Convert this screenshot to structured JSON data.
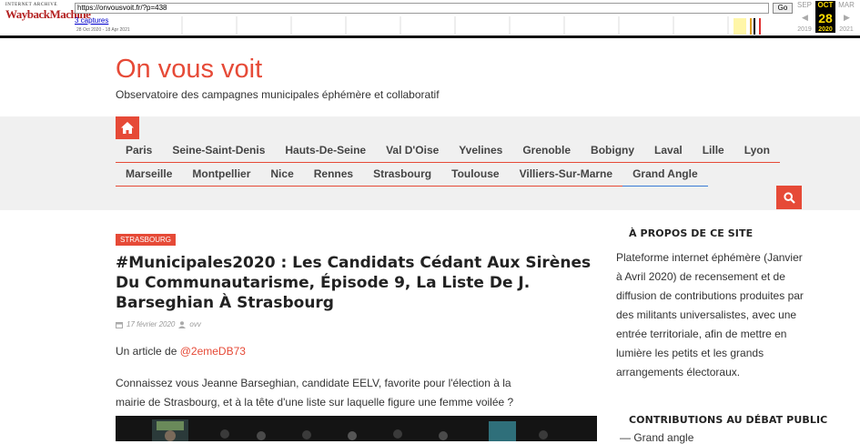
{
  "wayback": {
    "logo_top": "INTERNET ARCHIVE",
    "logo_main": "WaybackMachine",
    "url": "https://onvousvoit.fr/?p=438",
    "go_label": "Go",
    "captures": "3 captures",
    "range": "28 Oct 2020 - 18 Apr 2021",
    "months": [
      "SEP",
      "OCT",
      "MAR"
    ],
    "day": "28",
    "years": [
      "2019",
      "2020",
      "2021"
    ]
  },
  "site": {
    "title": "On vous voit",
    "tagline": "Observatoire des campagnes municipales éphémère et collaboratif",
    "accent": "#e64a37"
  },
  "nav": {
    "row1": [
      "Paris",
      "Seine-Saint-Denis",
      "Hauts-De-Seine",
      "Val D'Oise",
      "Yvelines",
      "Grenoble",
      "Bobigny",
      "Laval",
      "Lille",
      "Lyon"
    ],
    "row2": [
      "Marseille",
      "Montpellier",
      "Nice",
      "Rennes",
      "Strasbourg",
      "Toulouse",
      "Villiers-Sur-Marne",
      "Grand Angle"
    ]
  },
  "article": {
    "category": "STRASBOURG",
    "title": "#Municipales2020 : Les Candidats Cédant Aux Sirènes Du Communautarisme, Épisode 9, La Liste De J. Barseghian À Strasbourg",
    "date": "17 février 2020",
    "author": "ovv",
    "intro_prefix": "Un article de",
    "intro_link": "@2emeDB73",
    "body": "Connaissez vous Jeanne Barseghian, candidate EELV, favorite pour l'élection à la mairie de Strasbourg, et à la tête d'une liste sur laquelle figure une femme voilée ?"
  },
  "sidebar": {
    "about_title": "À PROPOS DE CE SITE",
    "about_text": "Plateforme internet éphémère (Janvier à Avril 2020) de recensement et de diffusion de contributions produites par des militants universalistes, avec une entrée territoriale, afin de mettre en lumière les petits et les grands arrangements électoraux.",
    "contrib_title": "CONTRIBUTIONS AU DÉBAT PUBLIC",
    "contrib_items": [
      "Grand angle"
    ]
  }
}
